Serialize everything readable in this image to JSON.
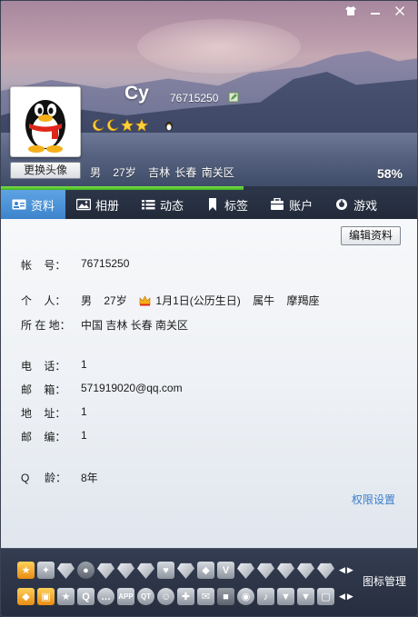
{
  "window": {
    "controls": [
      "skin",
      "minimize",
      "close"
    ]
  },
  "header": {
    "nickname": "Cy",
    "qq_number": "76715250",
    "change_avatar_label": "更换头像",
    "gender": "男",
    "age": "27岁",
    "location": "吉林 长春 南关区",
    "completion_percent": "58%",
    "completion_value": 58,
    "level_icons": [
      "moon",
      "moon",
      "star",
      "star"
    ]
  },
  "tabs": [
    {
      "label": "资料",
      "icon": "profile-card-icon",
      "active": true
    },
    {
      "label": "相册",
      "icon": "photo-album-icon",
      "active": false
    },
    {
      "label": "动态",
      "icon": "feed-list-icon",
      "active": false
    },
    {
      "label": "标签",
      "icon": "bookmark-icon",
      "active": false
    },
    {
      "label": "账户",
      "icon": "wallet-icon",
      "active": false
    },
    {
      "label": "游戏",
      "icon": "game-icon",
      "active": false
    }
  ],
  "profile": {
    "edit_button": "编辑资料",
    "account": {
      "label": "帐    号：",
      "value": "76715250"
    },
    "personal": {
      "label": "个    人：",
      "gender": "男",
      "age": "27岁",
      "birthday": "1月1日(公历生日)",
      "zodiac": "属牛",
      "constellation": "摩羯座"
    },
    "location": {
      "label": "所 在 地：",
      "value": "中国 吉林 长春 南关区"
    },
    "phone": {
      "label": "电    话：",
      "value": "1"
    },
    "email": {
      "label": "邮    箱：",
      "value": "571919020@qq.com"
    },
    "address": {
      "label": "地    址：",
      "value": "1"
    },
    "postcode": {
      "label": "邮    编：",
      "value": "1"
    },
    "qage": {
      "label": "Q     龄：",
      "value": "8年"
    },
    "permission_link": "权限设置"
  },
  "tray": {
    "manage_label": "图标管理",
    "row1_icons": [
      "gold-badge-icon",
      "butterfly-icon",
      "diamond-icon",
      "penguin-diamond-icon",
      "diamond-icon",
      "diamond-icon",
      "diamond-icon",
      "heart-diamond-icon",
      "diamond-icon",
      "wing-diamond-icon",
      "vip-icon",
      "diamond-icon",
      "diamond-icon",
      "diamond-icon",
      "diamond-icon",
      "diamond-icon"
    ],
    "row2_icons": [
      "gold-shield-icon",
      "lock-icon",
      "star-icon",
      "qzone-icon",
      "chat-icon",
      "app-icon",
      "qt-icon",
      "penguin-face-icon",
      "puzzle-icon",
      "mail-icon",
      "cube-icon",
      "disc-icon",
      "music-icon",
      "shield-icon",
      "shield-icon",
      "square-icon"
    ]
  }
}
